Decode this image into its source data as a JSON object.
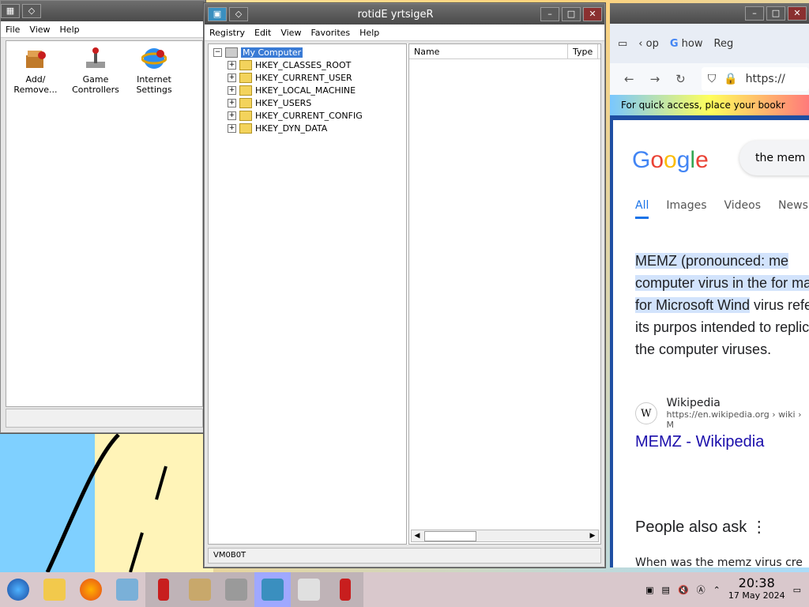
{
  "control_panel": {
    "menu": [
      "File",
      "View",
      "Help"
    ],
    "items": [
      {
        "label": "Add/\nRemove...",
        "icon": "add-remove-programs-icon"
      },
      {
        "label": "Game\nControllers",
        "icon": "game-controllers-icon"
      },
      {
        "label": "Internet\nSettings",
        "icon": "internet-settings-icon"
      }
    ]
  },
  "registry": {
    "title": "rotidE yrtsigeR",
    "menu": [
      "Registry",
      "Edit",
      "View",
      "Favorites",
      "Help"
    ],
    "root": "My Computer",
    "keys": [
      "HKEY_CLASSES_ROOT",
      "HKEY_CURRENT_USER",
      "HKEY_LOCAL_MACHINE",
      "HKEY_USERS",
      "HKEY_CURRENT_CONFIG",
      "HKEY_DYN_DATA"
    ],
    "columns": [
      "Name",
      "Type"
    ],
    "status": "VM0B0T"
  },
  "browser": {
    "tabs": [
      "op",
      "how",
      "Reg"
    ],
    "url": "https://",
    "bookmarks_hint": "For quick access, place your bookr",
    "search_text": "the mem",
    "logo": "Google",
    "search_tabs": [
      "All",
      "Images",
      "Videos",
      "News"
    ],
    "snippet_highlight": "MEMZ (pronounced: me computer virus in the for made for Microsoft Wind",
    "snippet_rest": "virus refers to its purpos intended to replicate the computer viruses.",
    "source_name": "Wikipedia",
    "source_url": "https://en.wikipedia.org › wiki › M",
    "result_title": "MEMZ - Wikipedia",
    "people_also_ask": "People also ask",
    "question": "When was the memz virus cre"
  },
  "taskbar": {
    "time": "20:38",
    "date": "17 May 2024"
  },
  "colors": {
    "taskbar_bg": "#d9c8cc",
    "selection": "#3a7bd5",
    "link": "#1a0dab",
    "google_blue": "#1a73e8"
  }
}
